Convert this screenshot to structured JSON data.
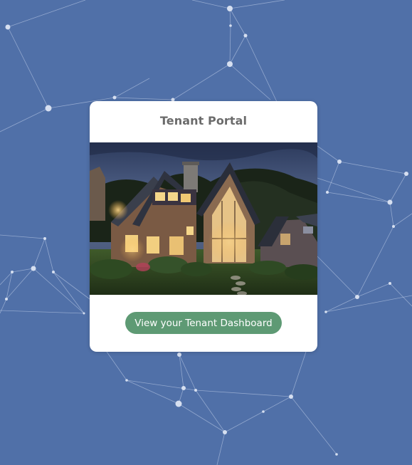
{
  "card": {
    "title": "Tenant Portal",
    "image_alt": "house-at-dusk-photo",
    "button_label": "View your Tenant Dashboard"
  },
  "colors": {
    "background": "#5070a8",
    "card": "#ffffff",
    "button": "#5e9a74",
    "button_text": "#ffffff",
    "title_text": "#6b6b6b"
  }
}
